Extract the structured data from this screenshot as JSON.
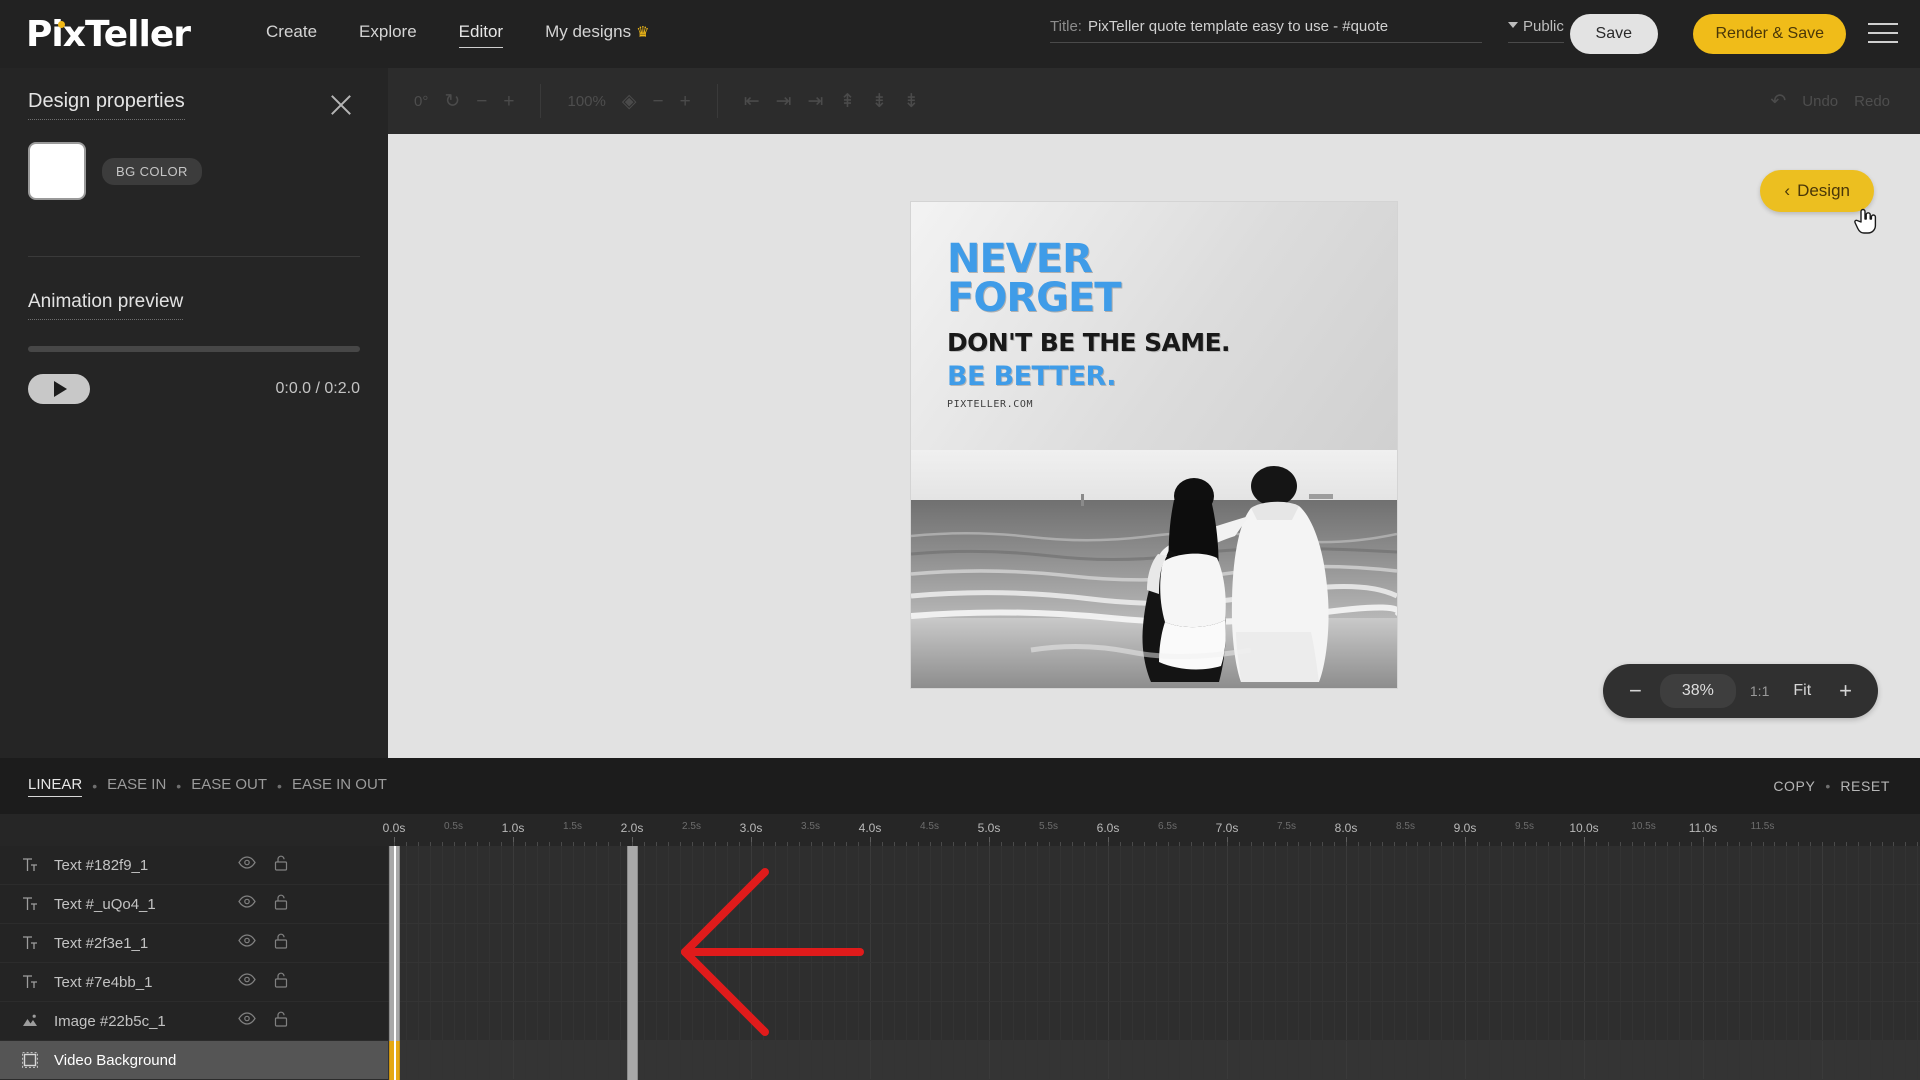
{
  "app": {
    "logo": "PixTeller",
    "accent_yellow": "#f0bc19",
    "accent_blue": "#3f9ce8"
  },
  "topnav": {
    "items": [
      {
        "label": "Create",
        "active": false,
        "crown": false
      },
      {
        "label": "Explore",
        "active": false,
        "crown": false
      },
      {
        "label": "Editor",
        "active": true,
        "crown": false
      },
      {
        "label": "My designs",
        "active": false,
        "crown": true
      }
    ],
    "title_label": "Title:",
    "title_value": "PixTeller quote template easy to use - #quote",
    "visibility": "Public",
    "save_label": "Save",
    "render_label": "Render & Save",
    "menu_icon": "hamburger-icon"
  },
  "sidebar": {
    "panel_title": "Design properties",
    "close_icon": "close-icon",
    "bg_color_badge": "BG COLOR",
    "bg_color_value": "#ffffff",
    "animation_title": "Animation preview",
    "play_icon": "play-icon",
    "time_code": "0:0.0 / 0:2.0"
  },
  "canvas_toolbar": {
    "rotation_value": "0°",
    "rotation_icon": "rotate-icon",
    "rotation_minus": "−",
    "rotation_plus": "+",
    "opacity_value": "100%",
    "opacity_icon": "checkerboard-icon",
    "opacity_minus": "−",
    "opacity_plus": "+",
    "align_icons": [
      "align-left-icon",
      "align-center-horizontal-icon",
      "align-right-icon",
      "align-top-icon",
      "align-middle-vertical-icon",
      "align-bottom-icon"
    ],
    "undo_label": "Undo",
    "redo_label": "Redo",
    "undo_icon": "undo-icon",
    "redo_icon": "redo-icon"
  },
  "artboard": {
    "line1": "NEVER",
    "line2": "FORGET",
    "line3": "DON'T BE THE SAME.",
    "line4": "BE BETTER.",
    "url": "PIXTELLER.COM"
  },
  "canvas": {
    "design_button": "Design",
    "design_caret": "‹",
    "cursor_icon": "hand-pointer-cursor"
  },
  "zoom_controls": {
    "minus": "−",
    "value": "38%",
    "one_to_one": "1:1",
    "fit": "Fit",
    "plus": "+"
  },
  "timeline": {
    "easings": [
      "LINEAR",
      "EASE IN",
      "EASE OUT",
      "EASE IN OUT"
    ],
    "active_easing": "LINEAR",
    "separator": "•",
    "copy_label": "COPY",
    "reset_label": "RESET",
    "ruler_major": [
      "0.0s",
      "1.0s",
      "2.0s",
      "3.0s",
      "4.0s",
      "5.0s",
      "6.0s",
      "7.0s",
      "8.0s",
      "9.0s",
      "10.0s",
      "11.0s"
    ],
    "ruler_minor": [
      "0.5s",
      "1.5s",
      "2.5s",
      "3.5s",
      "4.5s",
      "5.5s",
      "6.5s",
      "7.5s",
      "8.5s",
      "9.5s",
      "10.5s",
      "11.5s"
    ],
    "playhead_time": "0.0s",
    "layers": [
      {
        "name": "Text #182f9_1",
        "icon": "text-layer-icon",
        "selected": false,
        "keyframes": [
          "0.0s",
          "2.0s"
        ],
        "kf_color": "#a9a9a9"
      },
      {
        "name": "Text #_uQo4_1",
        "icon": "text-layer-icon",
        "selected": false,
        "keyframes": [
          "0.0s",
          "2.0s"
        ],
        "kf_color": "#a9a9a9"
      },
      {
        "name": "Text #2f3e1_1",
        "icon": "text-layer-icon",
        "selected": false,
        "keyframes": [
          "0.0s",
          "2.0s"
        ],
        "kf_color": "#a9a9a9"
      },
      {
        "name": "Text #7e4bb_1",
        "icon": "text-layer-icon",
        "selected": false,
        "keyframes": [
          "0.0s",
          "2.0s"
        ],
        "kf_color": "#a9a9a9"
      },
      {
        "name": "Image #22b5c_1",
        "icon": "image-layer-icon",
        "selected": false,
        "keyframes": [
          "0.0s",
          "2.0s"
        ],
        "kf_color": "#a9a9a9"
      },
      {
        "name": "Video Background",
        "icon": "video-layer-icon",
        "selected": true,
        "keyframes": [
          "0.0s",
          "2.0s"
        ],
        "kf_color": "#e5a812"
      }
    ],
    "eye_icon": "eye-icon",
    "lock_icon": "unlock-icon"
  },
  "annotation": {
    "shape": "red-left-arrow",
    "color": "#e01b1b"
  }
}
